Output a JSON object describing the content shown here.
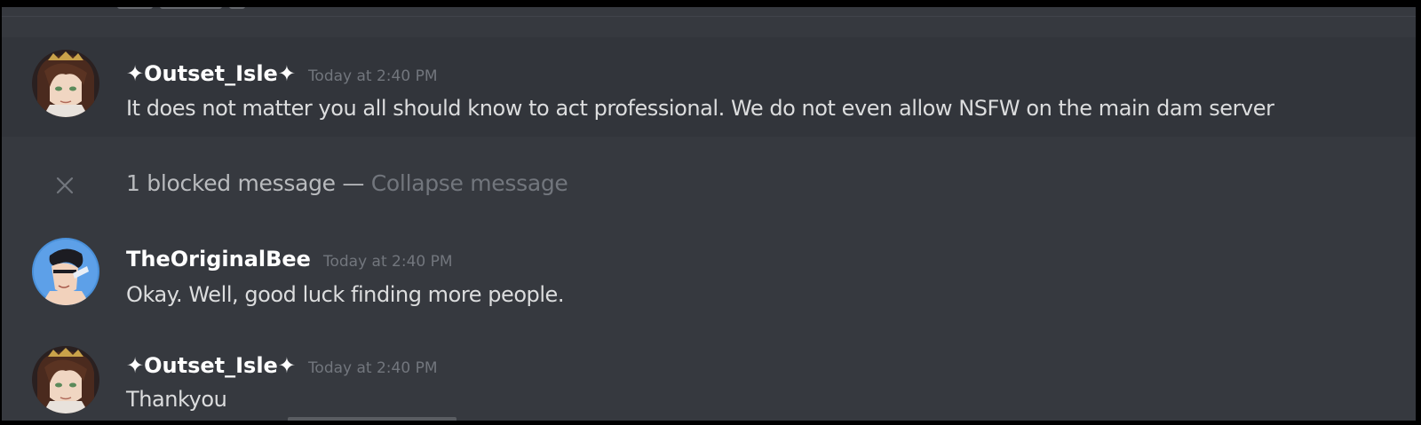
{
  "messages": [
    {
      "username": "✦Outset_Isle✦",
      "timestamp": "Today at 2:40 PM",
      "content": "It does not matter you all should know to act professional. We do not even allow NSFW on the main dam server",
      "avatar": "outset-isle-avatar"
    },
    {
      "username": "TheOriginalBee",
      "timestamp": "Today at 2:40 PM",
      "content": "Okay. Well, good luck finding more people.",
      "avatar": "theoriginalbee-avatar"
    },
    {
      "username": "✦Outset_Isle✦",
      "timestamp": "Today at 2:40 PM",
      "content": "Thankyou",
      "avatar": "outset-isle-avatar"
    }
  ],
  "blocked": {
    "count_text": "1 blocked message",
    "separator": "—",
    "collapse_text": "Collapse message",
    "icon": "close-icon"
  },
  "colors": {
    "background": "#36393f",
    "hover_background": "#32353b",
    "username": "#ffffff",
    "timestamp": "#72767d",
    "message_text": "#dcddde",
    "muted_text": "#72767d"
  }
}
